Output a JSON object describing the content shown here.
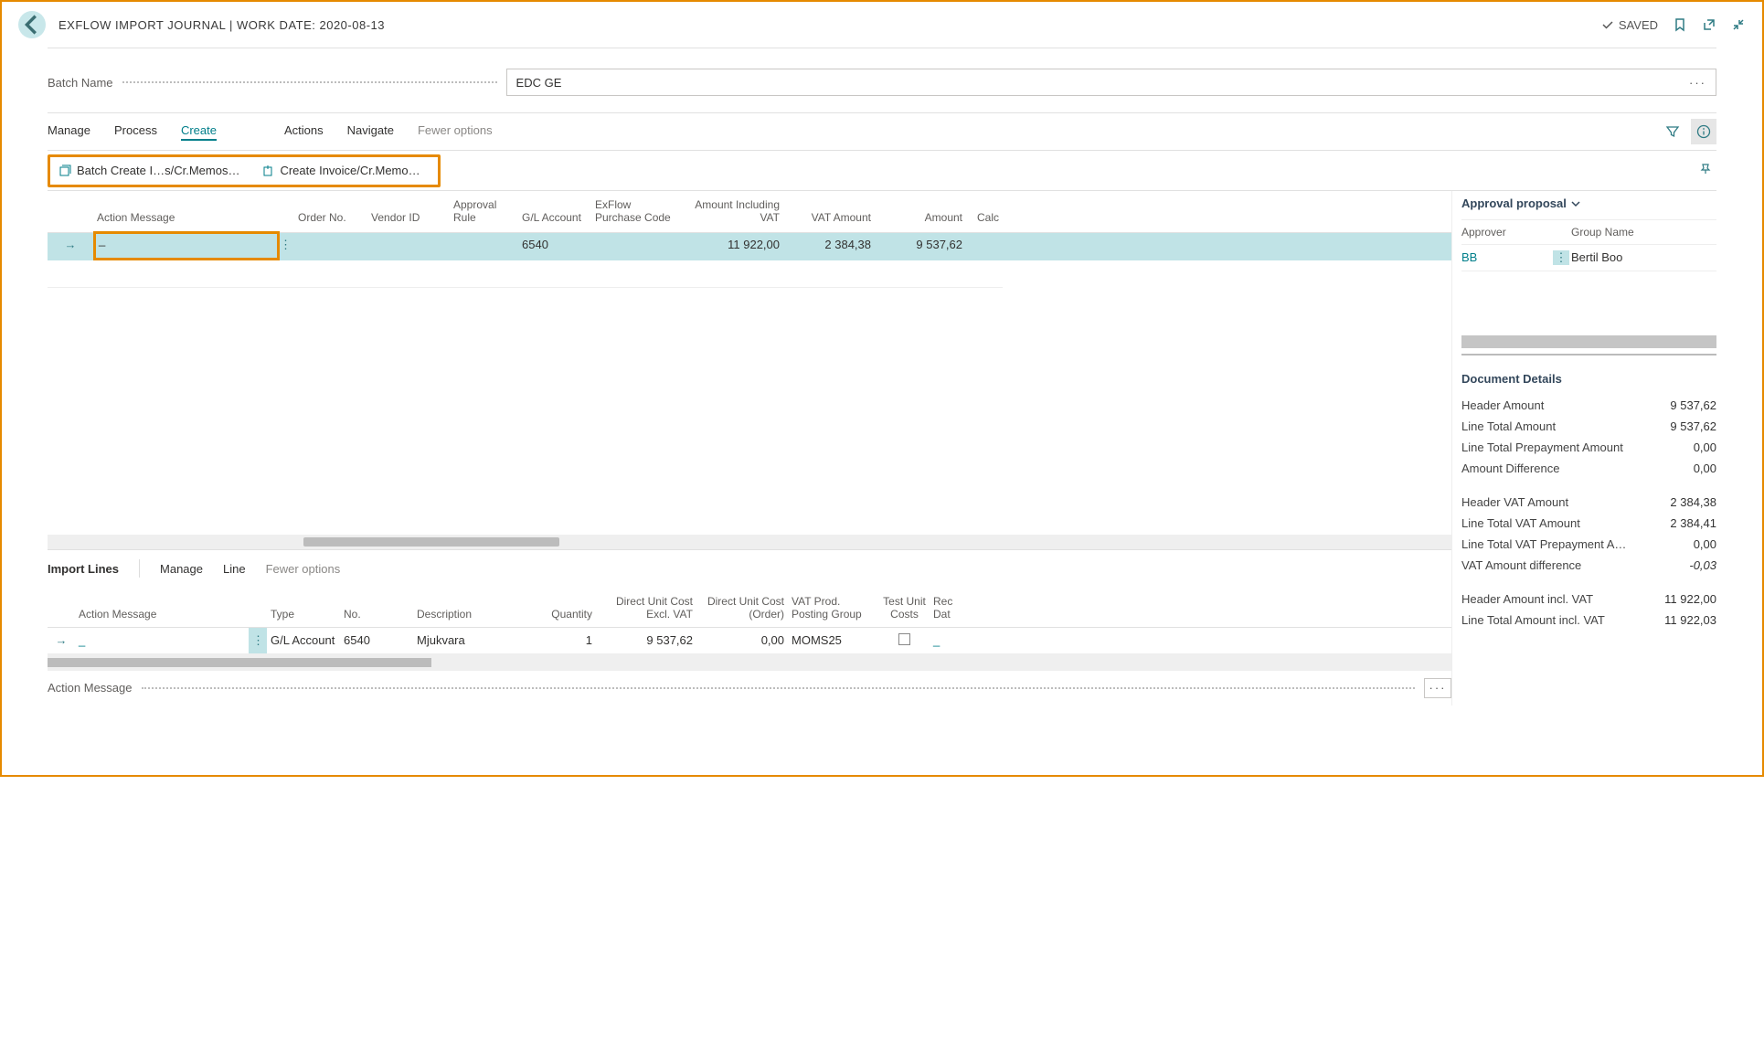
{
  "header": {
    "title": "EXFLOW IMPORT JOURNAL | WORK DATE: 2020-08-13",
    "saved": "SAVED"
  },
  "batch": {
    "label": "Batch Name",
    "value": "EDC GE"
  },
  "tabs": {
    "manage": "Manage",
    "process": "Process",
    "create": "Create",
    "actions": "Actions",
    "navigate": "Navigate",
    "fewer": "Fewer options"
  },
  "subactions": {
    "batchCreate": "Batch Create I…s/Cr.Memos…",
    "createInvoice": "Create Invoice/Cr.Memo…"
  },
  "mainGrid": {
    "cols": {
      "actionMsg": "Action Message",
      "orderNo": "Order No.",
      "vendorId": "Vendor ID",
      "approvalRule": "Approval Rule",
      "glAccount": "G/L Account",
      "exflowPurchase": "ExFlow Purchase Code",
      "amountInclVat": "Amount Including VAT",
      "vatAmount": "VAT Amount",
      "amount": "Amount",
      "calc": "Calc"
    },
    "row": {
      "action": "_",
      "gl": "6540",
      "inclVat": "11 922,00",
      "vat": "2 384,38",
      "amount": "9 537,62"
    }
  },
  "importLines": {
    "title": "Import Lines",
    "manage": "Manage",
    "line": "Line",
    "fewer": "Fewer options",
    "cols": {
      "actionMsg": "Action Message",
      "type": "Type",
      "no": "No.",
      "desc": "Description",
      "qty": "Quantity",
      "directCost": "Direct Unit Cost Excl. VAT",
      "directOrder": "Direct Unit Cost (Order)",
      "vatProd": "VAT Prod. Posting Group",
      "testCosts": "Test Unit Costs",
      "recDate": "Rec Dat"
    },
    "row": {
      "action": "_",
      "type": "G/L Account",
      "no": "6540",
      "desc": "Mjukvara",
      "qty": "1",
      "directCost": "9 537,62",
      "directOrder": "0,00",
      "vatProd": "MOMS25",
      "recDate": "_"
    }
  },
  "footer": {
    "label": "Action Message"
  },
  "right": {
    "approvalTitle": "Approval proposal",
    "approverH": "Approver",
    "groupH": "Group Name",
    "approver": "BB",
    "group": "Bertil Boo",
    "docTitle": "Document Details",
    "items": {
      "headerAmount": {
        "l": "Header Amount",
        "v": "9 537,62"
      },
      "lineTotal": {
        "l": "Line Total Amount",
        "v": "9 537,62"
      },
      "linePrepay": {
        "l": "Line Total Prepayment Amount",
        "v": "0,00"
      },
      "amountDiff": {
        "l": "Amount Difference",
        "v": "0,00"
      },
      "headerVat": {
        "l": "Header VAT Amount",
        "v": "2 384,38"
      },
      "lineVat": {
        "l": "Line Total VAT Amount",
        "v": "2 384,41"
      },
      "lineVatPrepay": {
        "l": "Line Total VAT Prepayment A…",
        "v": "0,00"
      },
      "vatDiff": {
        "l": "VAT Amount difference",
        "v": "-0,03"
      },
      "headerIncl": {
        "l": "Header Amount incl. VAT",
        "v": "11 922,00"
      },
      "lineIncl": {
        "l": "Line Total Amount incl. VAT",
        "v": "11 922,03"
      }
    }
  }
}
